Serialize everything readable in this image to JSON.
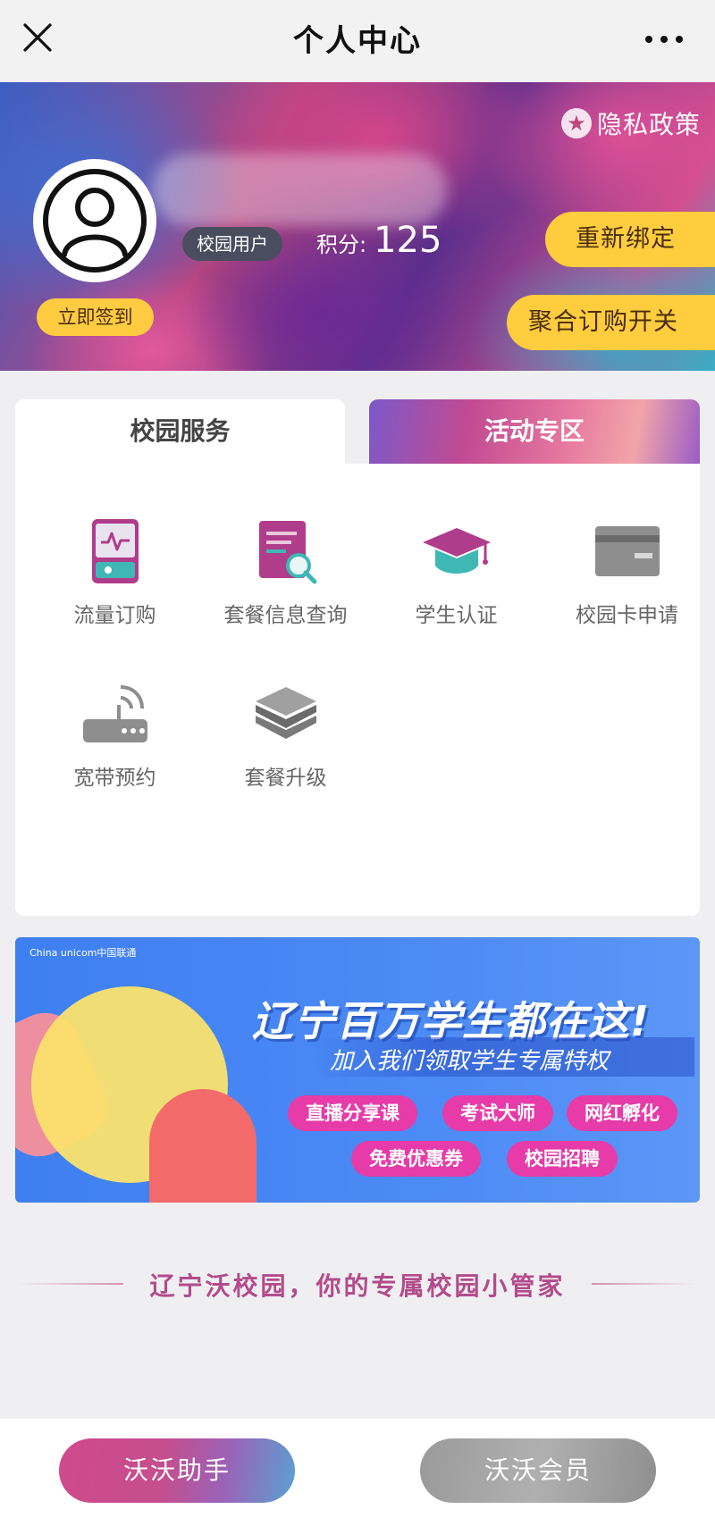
{
  "topbar": {
    "title": "个人中心"
  },
  "profile": {
    "privacy_label": "隐私政策",
    "user_badge": "校园用户",
    "points_label": "积分:",
    "points_value": "125",
    "signin_label": "立即签到",
    "rebind_label": "重新绑定",
    "merge_label": "聚合订购开关"
  },
  "tabs": [
    {
      "label": "校园服务",
      "active": true
    },
    {
      "label": "活动专区",
      "active": false
    }
  ],
  "services": [
    {
      "label": "流量订购",
      "icon": "phone-data-icon"
    },
    {
      "label": "套餐信息查询",
      "icon": "document-search-icon"
    },
    {
      "label": "学生认证",
      "icon": "graduation-cap-icon"
    },
    {
      "label": "校园卡申请",
      "icon": "card-icon"
    },
    {
      "label": "宽带预约",
      "icon": "router-icon"
    },
    {
      "label": "套餐升级",
      "icon": "layers-icon"
    }
  ],
  "banner": {
    "logo_text": "China unicom中国联通",
    "title": "辽宁百万学生都在这!",
    "subtitle": "加入我们领取学生专属特权",
    "chips": [
      "直播分享课",
      "考试大师",
      "网红孵化",
      "免费优惠券",
      "校园招聘"
    ]
  },
  "slogan": "辽宁沃校园，你的专属校园小管家",
  "bottom_buttons": [
    "沃沃助手",
    "沃沃会员"
  ],
  "colors": {
    "accent_yellow": "#ffcd3d",
    "chip_pink": "#e63ba8",
    "banner_blue": "#4c8af5"
  }
}
